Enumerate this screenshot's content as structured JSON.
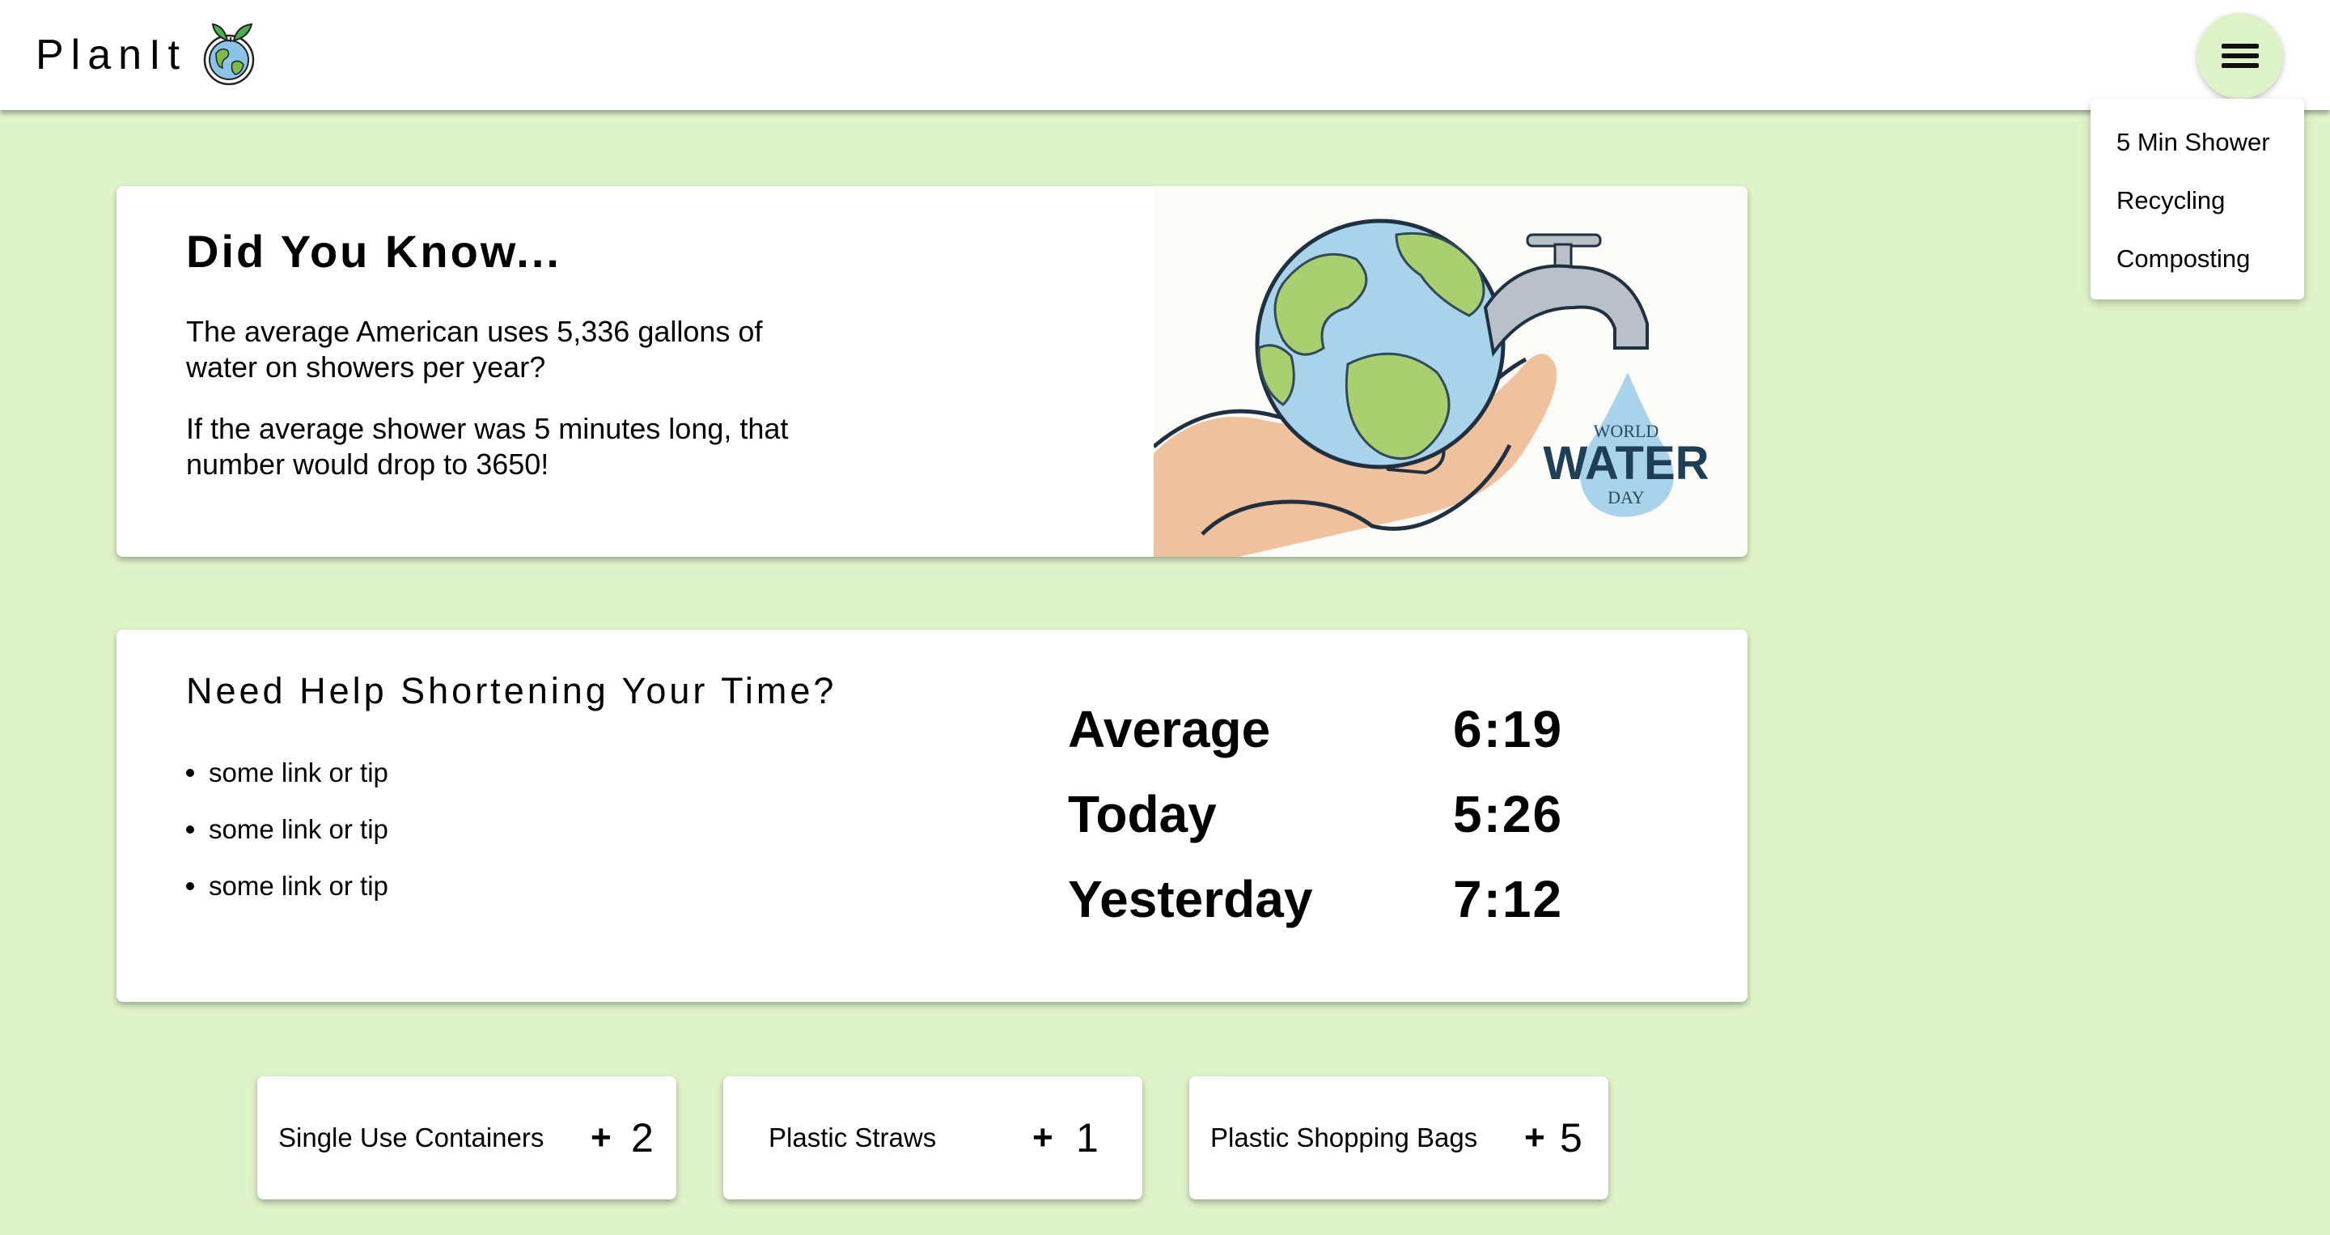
{
  "header": {
    "brand": "PlanIt",
    "menu_icon": "hamburger-menu-icon",
    "logo_icon": "globe-leaf-icon"
  },
  "menu": {
    "items": [
      {
        "label": "5 Min Shower"
      },
      {
        "label": "Recycling"
      },
      {
        "label": "Composting"
      }
    ]
  },
  "did_you_know": {
    "title": "Did You Know...",
    "paragraph1": "The average American uses 5,336 gallons of water on showers per year?",
    "paragraph2": "If the average shower was 5 minutes long, that number would drop to 3650!",
    "illustration": {
      "icon": "earth-faucet-hand-illustration",
      "text_line1": "WORLD",
      "text_line2": "WATER",
      "text_line3": "DAY"
    }
  },
  "help": {
    "title": "Need Help Shortening Your Time?",
    "tips": [
      {
        "label": "some link or tip"
      },
      {
        "label": "some link or tip"
      },
      {
        "label": "some link or tip"
      }
    ]
  },
  "stats": [
    {
      "label": "Average",
      "value": "6:19"
    },
    {
      "label": "Today",
      "value": "5:26"
    },
    {
      "label": "Yesterday",
      "value": "7:12"
    }
  ],
  "counters": [
    {
      "label": "Single Use Containers",
      "plus": "+",
      "value": "2"
    },
    {
      "label": "Plastic Straws",
      "plus": "+",
      "value": "1"
    },
    {
      "label": "Plastic Shopping Bags",
      "plus": "+",
      "value": "5"
    }
  ],
  "colors": {
    "background": "#dff3c9",
    "card": "#ffffff",
    "earth_water": "#a8d3ea",
    "earth_land": "#a9cf6f",
    "hand": "#efc19d",
    "faucet": "#b9c0c8"
  }
}
